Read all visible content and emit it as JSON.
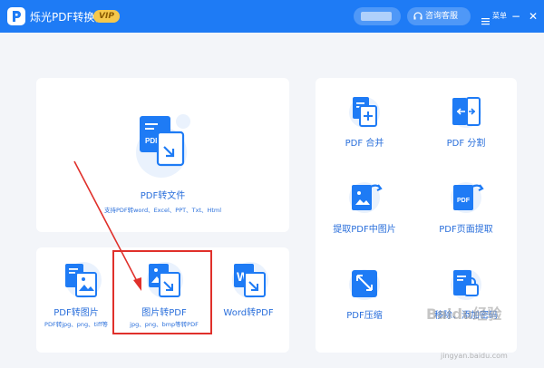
{
  "titlebar": {
    "app_title": "烁光PDF转换器",
    "vip": "VIP",
    "service": "咨询客服",
    "menu": "菜单",
    "minimize": "−",
    "close": "✕"
  },
  "big_card": {
    "label": "PDF转文件",
    "sublabel": "支持PDF转word、Excel、PPT、Txt、Html",
    "icon": "pdf-convert-icon"
  },
  "bottom_cards": [
    {
      "label": "PDF转图片",
      "sublabel": "PDF转jpg、png、tiff等",
      "icon": "pdf-to-image-icon"
    },
    {
      "label": "图片转PDF",
      "sublabel": "jpg、png、bmp等转PDF",
      "icon": "image-to-pdf-icon"
    },
    {
      "label": "Word转PDF",
      "sublabel": "",
      "icon": "word-to-pdf-icon"
    }
  ],
  "right_tools": [
    {
      "label": "PDF 合并",
      "icon": "pdf-merge-icon"
    },
    {
      "label": "PDF 分割",
      "icon": "pdf-split-icon"
    },
    {
      "label": "提取PDF中图片",
      "icon": "extract-image-icon"
    },
    {
      "label": "PDF页面提取",
      "icon": "page-extract-icon"
    },
    {
      "label": "PDF压缩",
      "icon": "pdf-compress-icon"
    },
    {
      "label": "移除、添加密码",
      "icon": "password-icon"
    }
  ],
  "watermark": {
    "text": "Baidu经验",
    "url": "jingyan.baidu.com"
  },
  "colors": {
    "titlebar": "#1e7bf5",
    "accent": "#2a6fdb",
    "highlight": "#e0302b",
    "vip": "#f5c84c"
  }
}
